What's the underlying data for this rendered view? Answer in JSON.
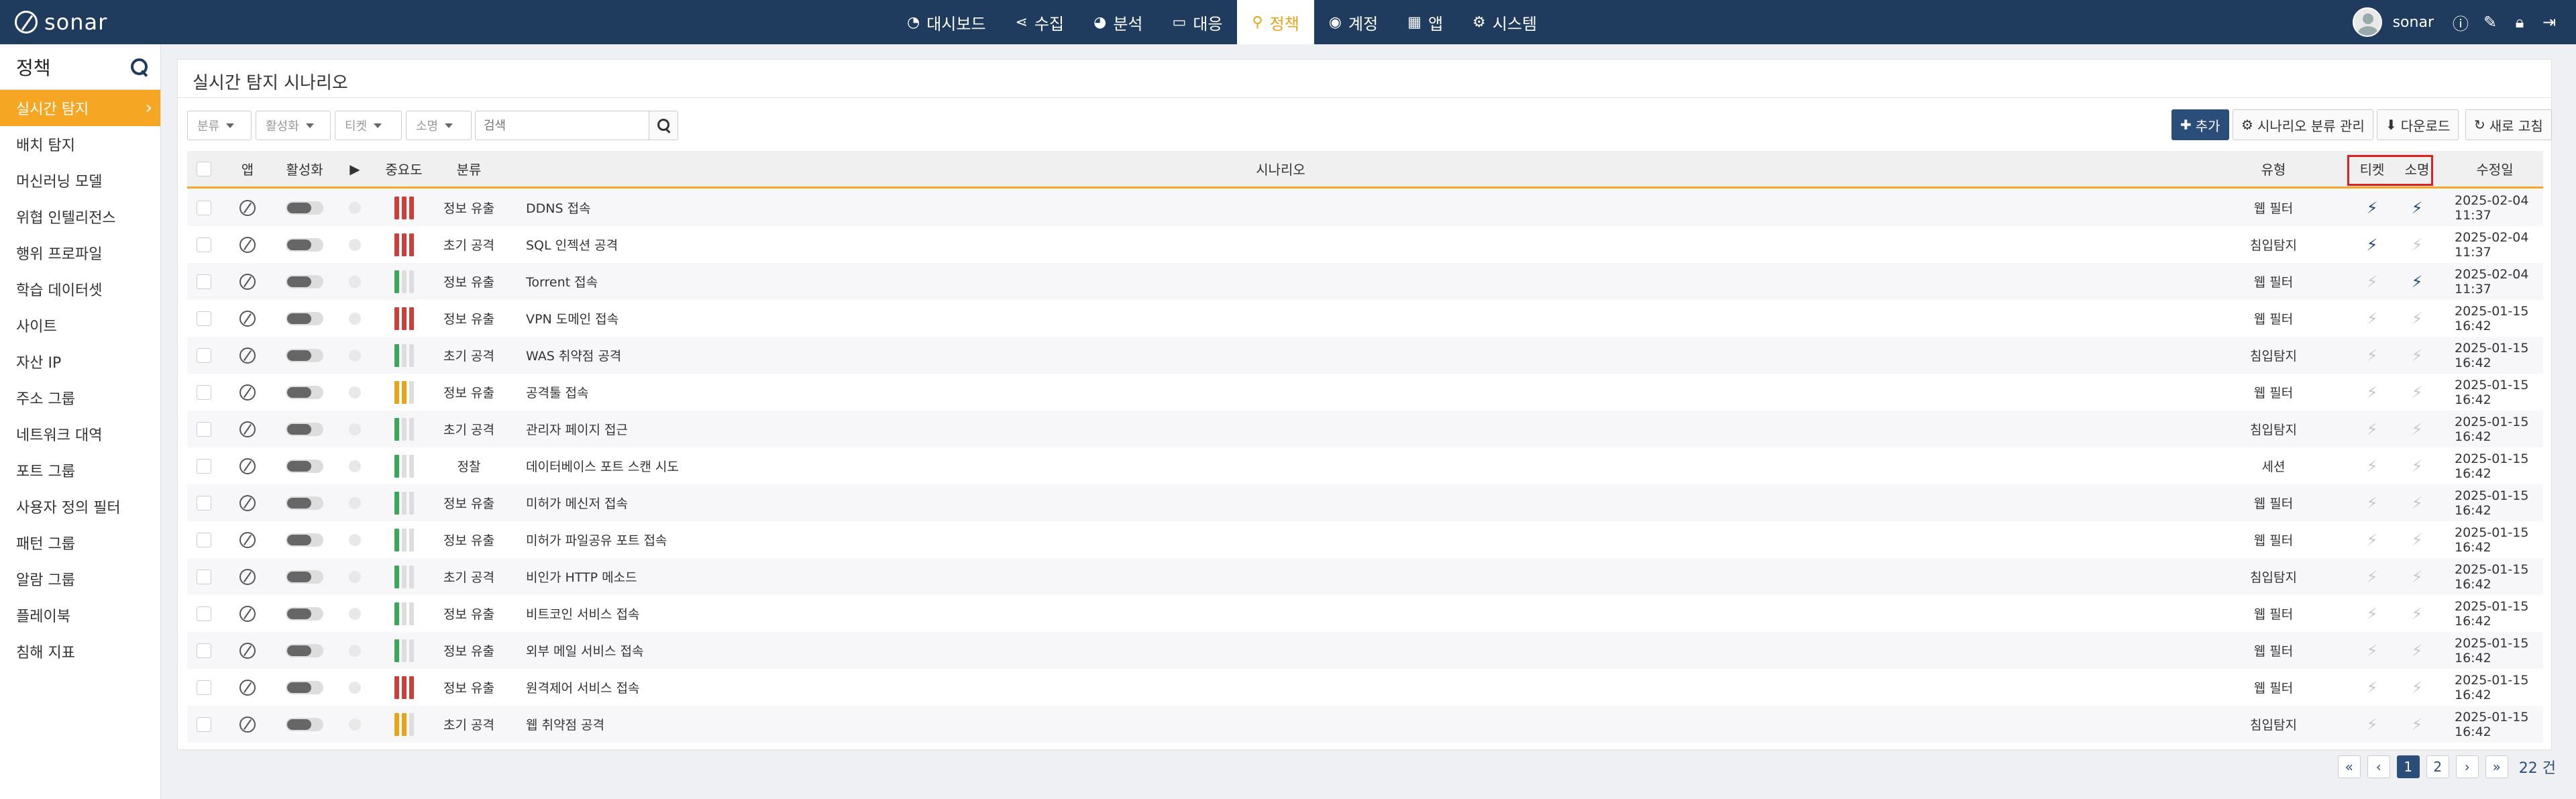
{
  "brand": {
    "name": "sonar"
  },
  "nav": [
    {
      "label": "대시보드",
      "icon": "dashboard-icon",
      "glyph": "◔",
      "active": false
    },
    {
      "label": "수집",
      "icon": "share-icon",
      "glyph": "⋖",
      "active": false
    },
    {
      "label": "분석",
      "icon": "pie-chart-icon",
      "glyph": "◕",
      "active": false
    },
    {
      "label": "대응",
      "icon": "laptop-icon",
      "glyph": "▭",
      "active": false
    },
    {
      "label": "정책",
      "icon": "search-icon",
      "glyph": "⚲",
      "active": true
    },
    {
      "label": "계정",
      "icon": "user-circle-icon",
      "glyph": "◉",
      "active": false
    },
    {
      "label": "앱",
      "icon": "apps-grid-icon",
      "glyph": "▦",
      "active": false
    },
    {
      "label": "시스템",
      "icon": "gear-icon",
      "glyph": "⚙",
      "active": false
    }
  ],
  "user": {
    "name": "sonar"
  },
  "sidebar": {
    "title": "정책",
    "items": [
      {
        "label": "실시간 탐지",
        "active": true
      },
      {
        "label": "배치 탐지",
        "active": false
      },
      {
        "label": "머신러닝 모델",
        "active": false
      },
      {
        "label": "위협 인텔리전스",
        "active": false
      },
      {
        "label": "행위 프로파일",
        "active": false
      },
      {
        "label": "학습 데이터셋",
        "active": false
      },
      {
        "label": "사이트",
        "active": false
      },
      {
        "label": "자산 IP",
        "active": false
      },
      {
        "label": "주소 그룹",
        "active": false
      },
      {
        "label": "네트워크 대역",
        "active": false
      },
      {
        "label": "포트 그룹",
        "active": false
      },
      {
        "label": "사용자 정의 필터",
        "active": false
      },
      {
        "label": "패턴 그룹",
        "active": false
      },
      {
        "label": "알람 그룹",
        "active": false
      },
      {
        "label": "플레이북",
        "active": false
      },
      {
        "label": "침해 지표",
        "active": false
      }
    ]
  },
  "main": {
    "title": "실시간 탐지 시나리오",
    "filters": [
      "분류",
      "활성화",
      "티켓",
      "소명"
    ],
    "search_placeholder": "검색",
    "buttons": {
      "add": "추가",
      "category_manage": "시나리오 분류 관리",
      "download": "다운로드",
      "refresh": "새로 고침"
    },
    "columns": {
      "app": "앱",
      "enabled": "활성화",
      "run": "▶",
      "severity": "중요도",
      "category": "분류",
      "scenario": "시나리오",
      "type": "유형",
      "ticket": "티켓",
      "explain": "소명",
      "modified": "수정일"
    },
    "rows": [
      {
        "category": "정보 유출",
        "scenario": "DDNS 접속",
        "type": "웹 필터",
        "severity": 3,
        "ticket": true,
        "explain": true,
        "modified": "2025-02-04 11:37"
      },
      {
        "category": "초기 공격",
        "scenario": "SQL 인젝션 공격",
        "type": "침입탐지",
        "severity": 3,
        "ticket": true,
        "explain": false,
        "modified": "2025-02-04 11:37"
      },
      {
        "category": "정보 유출",
        "scenario": "Torrent 접속",
        "type": "웹 필터",
        "severity": 1,
        "ticket": false,
        "explain": true,
        "modified": "2025-02-04 11:37"
      },
      {
        "category": "정보 유출",
        "scenario": "VPN 도메인 접속",
        "type": "웹 필터",
        "severity": 3,
        "ticket": false,
        "explain": false,
        "modified": "2025-01-15 16:42"
      },
      {
        "category": "초기 공격",
        "scenario": "WAS 취약점 공격",
        "type": "침입탐지",
        "severity": 1,
        "ticket": false,
        "explain": false,
        "modified": "2025-01-15 16:42"
      },
      {
        "category": "정보 유출",
        "scenario": "공격툴 접속",
        "type": "웹 필터",
        "severity": 2,
        "ticket": false,
        "explain": false,
        "modified": "2025-01-15 16:42"
      },
      {
        "category": "초기 공격",
        "scenario": "관리자 페이지 접근",
        "type": "침입탐지",
        "severity": 1,
        "ticket": false,
        "explain": false,
        "modified": "2025-01-15 16:42"
      },
      {
        "category": "정찰",
        "scenario": "데이터베이스 포트 스캔 시도",
        "type": "세션",
        "severity": 1,
        "ticket": false,
        "explain": false,
        "modified": "2025-01-15 16:42"
      },
      {
        "category": "정보 유출",
        "scenario": "미허가 메신저 접속",
        "type": "웹 필터",
        "severity": 1,
        "ticket": false,
        "explain": false,
        "modified": "2025-01-15 16:42"
      },
      {
        "category": "정보 유출",
        "scenario": "미허가 파일공유 포트 접속",
        "type": "웹 필터",
        "severity": 1,
        "ticket": false,
        "explain": false,
        "modified": "2025-01-15 16:42"
      },
      {
        "category": "초기 공격",
        "scenario": "비인가 HTTP 메소드",
        "type": "침입탐지",
        "severity": 1,
        "ticket": false,
        "explain": false,
        "modified": "2025-01-15 16:42"
      },
      {
        "category": "정보 유출",
        "scenario": "비트코인 서비스 접속",
        "type": "웹 필터",
        "severity": 1,
        "ticket": false,
        "explain": false,
        "modified": "2025-01-15 16:42"
      },
      {
        "category": "정보 유출",
        "scenario": "외부 메일 서비스 접속",
        "type": "웹 필터",
        "severity": 1,
        "ticket": false,
        "explain": false,
        "modified": "2025-01-15 16:42"
      },
      {
        "category": "정보 유출",
        "scenario": "원격제어 서비스 접속",
        "type": "웹 필터",
        "severity": 3,
        "ticket": false,
        "explain": false,
        "modified": "2025-01-15 16:42"
      },
      {
        "category": "초기 공격",
        "scenario": "웹 취약점 공격",
        "type": "침입탐지",
        "severity": 2,
        "ticket": false,
        "explain": false,
        "modified": "2025-01-15 16:42"
      }
    ]
  },
  "pagination": {
    "first": "«",
    "prev": "‹",
    "pages": [
      "1",
      "2"
    ],
    "current": "1",
    "next": "›",
    "last": "»",
    "total": "22 건"
  },
  "colors": {
    "topbar": "#1f3c5e",
    "accent": "#f5a623",
    "sev_high": "#c9403a",
    "sev_mid": "#e8a317",
    "sev_low": "#3aa856",
    "highlight_box": "#e0201f"
  }
}
